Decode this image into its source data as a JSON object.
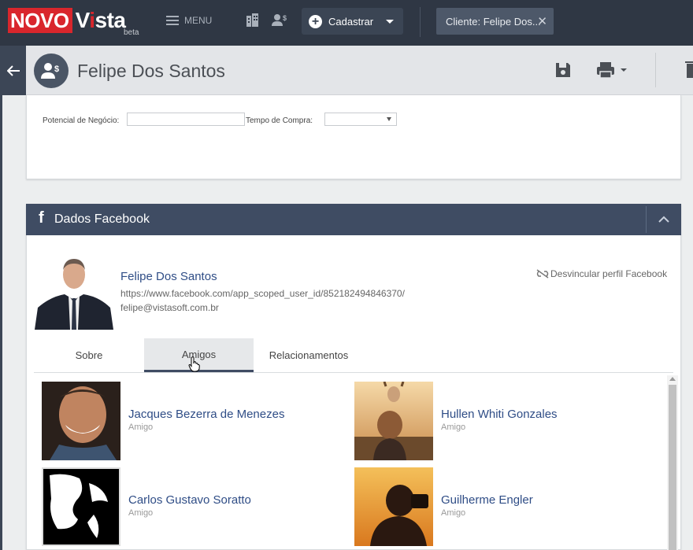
{
  "topbar": {
    "logo_novo": "NOVO",
    "logo_vista_pre": "V",
    "logo_vista_dot": "i",
    "logo_vista_post": "sta",
    "logo_beta": "beta",
    "menu_label": "MENU",
    "cadastrar_label": "Cadastrar",
    "client_tab_label": "Cliente: Felipe Dos...",
    "close_glyph": "✕"
  },
  "header": {
    "title": "Felipe Dos Santos"
  },
  "form": {
    "potencial_label": "Potencial de Negócio:",
    "potencial_value": "",
    "tempo_label": "Tempo de Compra:",
    "tempo_value": ""
  },
  "facebook": {
    "section_icon": "f",
    "section_title": "Dados Facebook",
    "profile": {
      "name": "Felipe Dos Santos",
      "url": "https://www.facebook.com/app_scoped_user_id/852182494846370/",
      "email": "felipe@vistasoft.com.br"
    },
    "unlink_label": "Desvincular perfil Facebook",
    "tabs": [
      {
        "label": "Sobre",
        "active": false
      },
      {
        "label": "Amigos",
        "active": true
      },
      {
        "label": "Relacionamentos",
        "active": false
      }
    ],
    "friends": [
      {
        "name": "Jacques Bezerra de Menezes",
        "relation": "Amigo"
      },
      {
        "name": "Hullen Whiti Gonzales",
        "relation": "Amigo"
      },
      {
        "name": "Carlos Gustavo Soratto",
        "relation": "Amigo"
      },
      {
        "name": "Guilherme Engler",
        "relation": "Amigo"
      }
    ]
  },
  "colors": {
    "topbar": "#2f3744",
    "brand_red": "#d9262c",
    "section_header": "#3f4c63",
    "link_blue": "#2f4d86"
  },
  "icons": [
    "menu-icon",
    "building-icon",
    "user-dollar-icon",
    "plus-circle-icon",
    "caret-down-icon",
    "close-icon",
    "back-arrow-icon",
    "save-icon",
    "print-icon",
    "trash-icon",
    "facebook-icon",
    "chevron-up-icon",
    "unlink-icon",
    "hand-cursor-icon"
  ]
}
